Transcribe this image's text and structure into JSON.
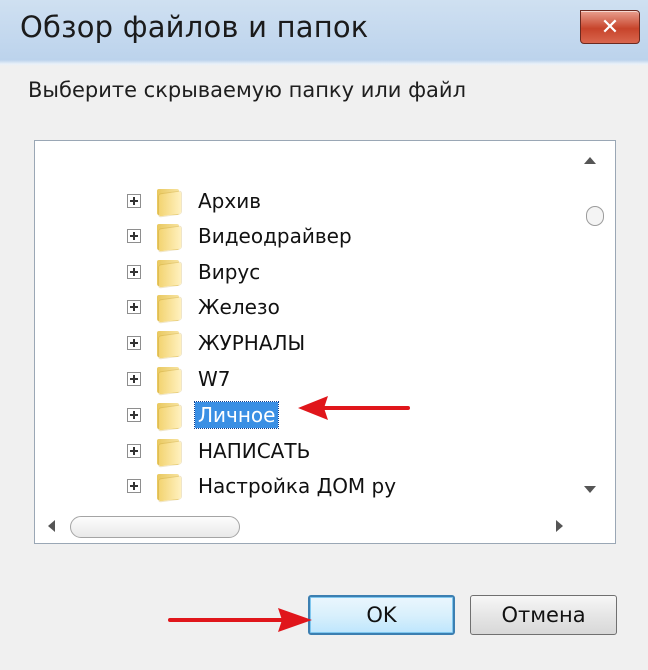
{
  "window": {
    "title": "Обзор файлов и папок",
    "close_label": "✕"
  },
  "instruction": "Выберите скрываемую папку или файл",
  "tree": {
    "items": [
      {
        "label": "Архив",
        "selected": false
      },
      {
        "label": "Видеодрайвер",
        "selected": false
      },
      {
        "label": "Вирус",
        "selected": false
      },
      {
        "label": "Железо",
        "selected": false
      },
      {
        "label": "ЖУРНАЛЫ",
        "selected": false
      },
      {
        "label": "W7",
        "selected": false
      },
      {
        "label": "Личное",
        "selected": true
      },
      {
        "label": "НАПИСАТЬ",
        "selected": false
      },
      {
        "label": "Настройка ДОМ ру",
        "selected": false
      }
    ]
  },
  "buttons": {
    "ok_label": "OK",
    "cancel_label": "Отмена"
  },
  "colors": {
    "selection": "#3a8fe4",
    "annotation_arrow": "#e0161b"
  }
}
